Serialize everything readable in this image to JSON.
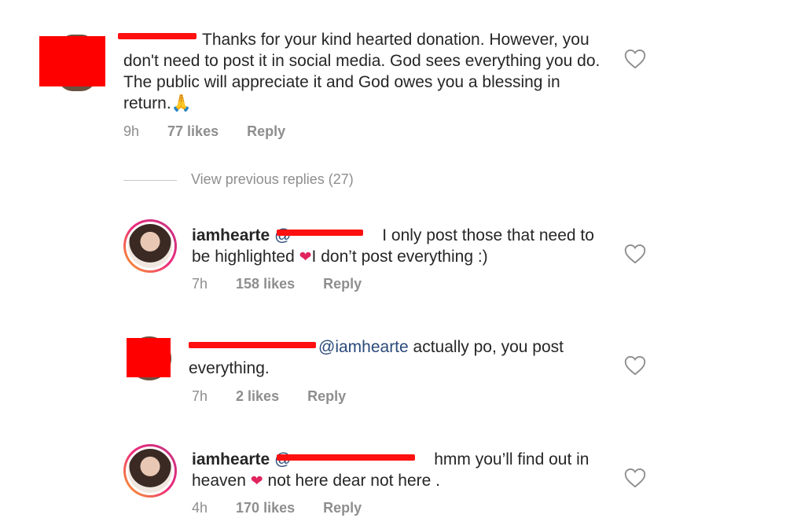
{
  "comments": [
    {
      "username_visible": "",
      "text": "Thanks for your kind hearted donation. However, you don't need to post it in social media. God sees everything you do. The public will appreciate it and God owes you a blessing in return.",
      "emoji": "🙏",
      "time": "9h",
      "likes": "77 likes",
      "reply": "Reply"
    },
    {
      "username": "iamhearte",
      "mention_prefix": "@",
      "text_line1": "I only post those that need to",
      "text_line2_a": "be highlighted",
      "text_line2_b": "I don’t post everything :)",
      "time": "7h",
      "likes": "158 likes",
      "reply": "Reply"
    },
    {
      "mention": "@iamhearte",
      "text_line1": "actually po, you post",
      "text_line2": "everything.",
      "time": "7h",
      "likes": "2 likes",
      "reply": "Reply"
    },
    {
      "username": "iamhearte",
      "mention_prefix": "@",
      "text_line1": "hmm you’ll find out in",
      "text_line2_a": "heaven",
      "text_line2_b": "not here dear not here .",
      "time": "4h",
      "likes": "170 likes",
      "reply": "Reply"
    }
  ],
  "view_previous_replies": "View previous replies (27)",
  "icons": {
    "like": "heart-outline-icon",
    "emoji_heart": "red-heart-emoji",
    "emoji_pray": "folded-hands-emoji"
  },
  "colors": {
    "redaction": "#ff0000",
    "meta_gray": "#8e8e8e",
    "mention_blue": "#2a4a7a"
  }
}
